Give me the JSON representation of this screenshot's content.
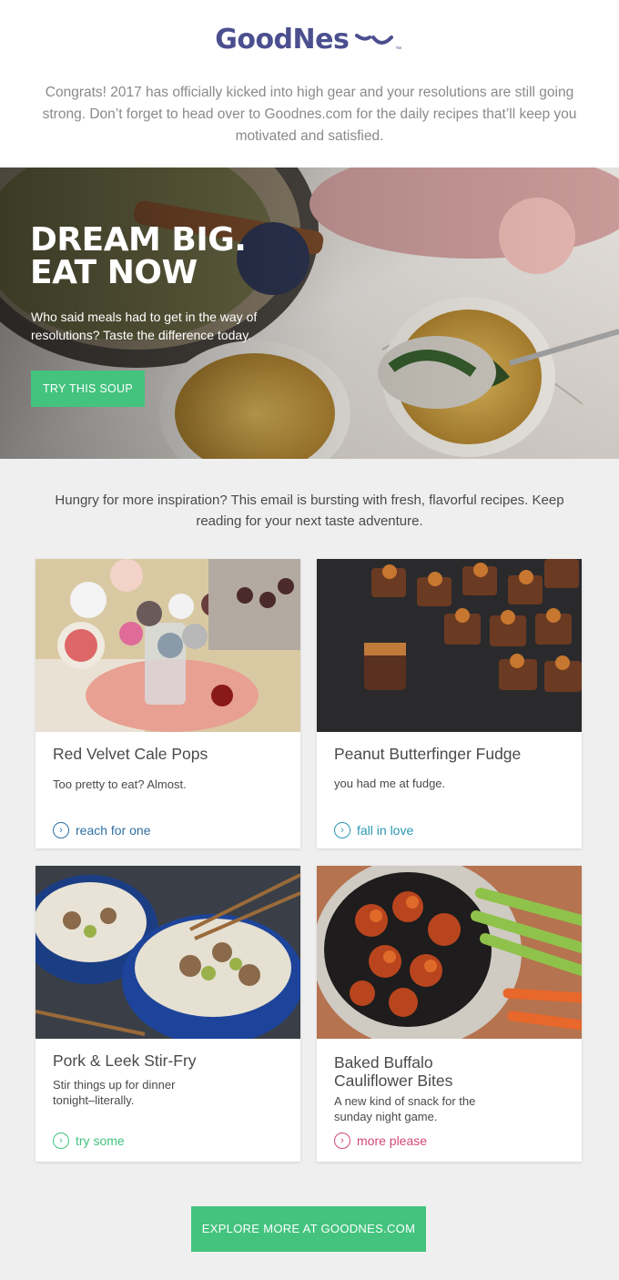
{
  "header": {
    "logo_text": "GoodNes",
    "logo_tm": "™",
    "intro": "Congrats! 2017 has officially kicked into high gear and your resolutions are still going strong. Don’t forget to head over to Goodnes.com for the daily recipes that’ll keep you motivated and satisfied."
  },
  "hero": {
    "title": "DREAM BIG.\nEAT NOW",
    "subtitle": "Who said meals had to get in the way of resolutions? Taste the difference today.",
    "button": "TRY THIS SOUP"
  },
  "inspiration": "Hungry for more inspiration? This email is bursting with fresh, flavorful recipes. Keep reading for your next taste adventure.",
  "cards": [
    {
      "title": "Red Velvet Cale Pops",
      "desc": "Too pretty to eat? Almost.",
      "cta": "reach for one",
      "cta_color": "#2f6fa3",
      "icon": "chevron-right-icon"
    },
    {
      "title": "Peanut Butterfinger Fudge",
      "desc": "you had me at fudge.",
      "cta": "fall in love",
      "cta_color": "#2b97b4",
      "icon": "chevron-right-icon"
    },
    {
      "title": "Pork & Leek Stir-Fry",
      "desc": "Stir things up for dinner tonight–literally.",
      "cta": "try some",
      "cta_color": "#43c37e",
      "icon": "chevron-right-icon"
    },
    {
      "title": "Baked Buffalo Cauliflower Bites",
      "desc": "A new kind of snack for the sunday night game.",
      "cta": "more please",
      "cta_color": "#d2477a",
      "icon": "chevron-right-icon"
    }
  ],
  "footer": {
    "button": "EXPLORE MORE AT GOODNES.COM"
  },
  "colors": {
    "brand": "#4b4f8f",
    "accent_green": "#43c37e",
    "background": "#efefef"
  }
}
